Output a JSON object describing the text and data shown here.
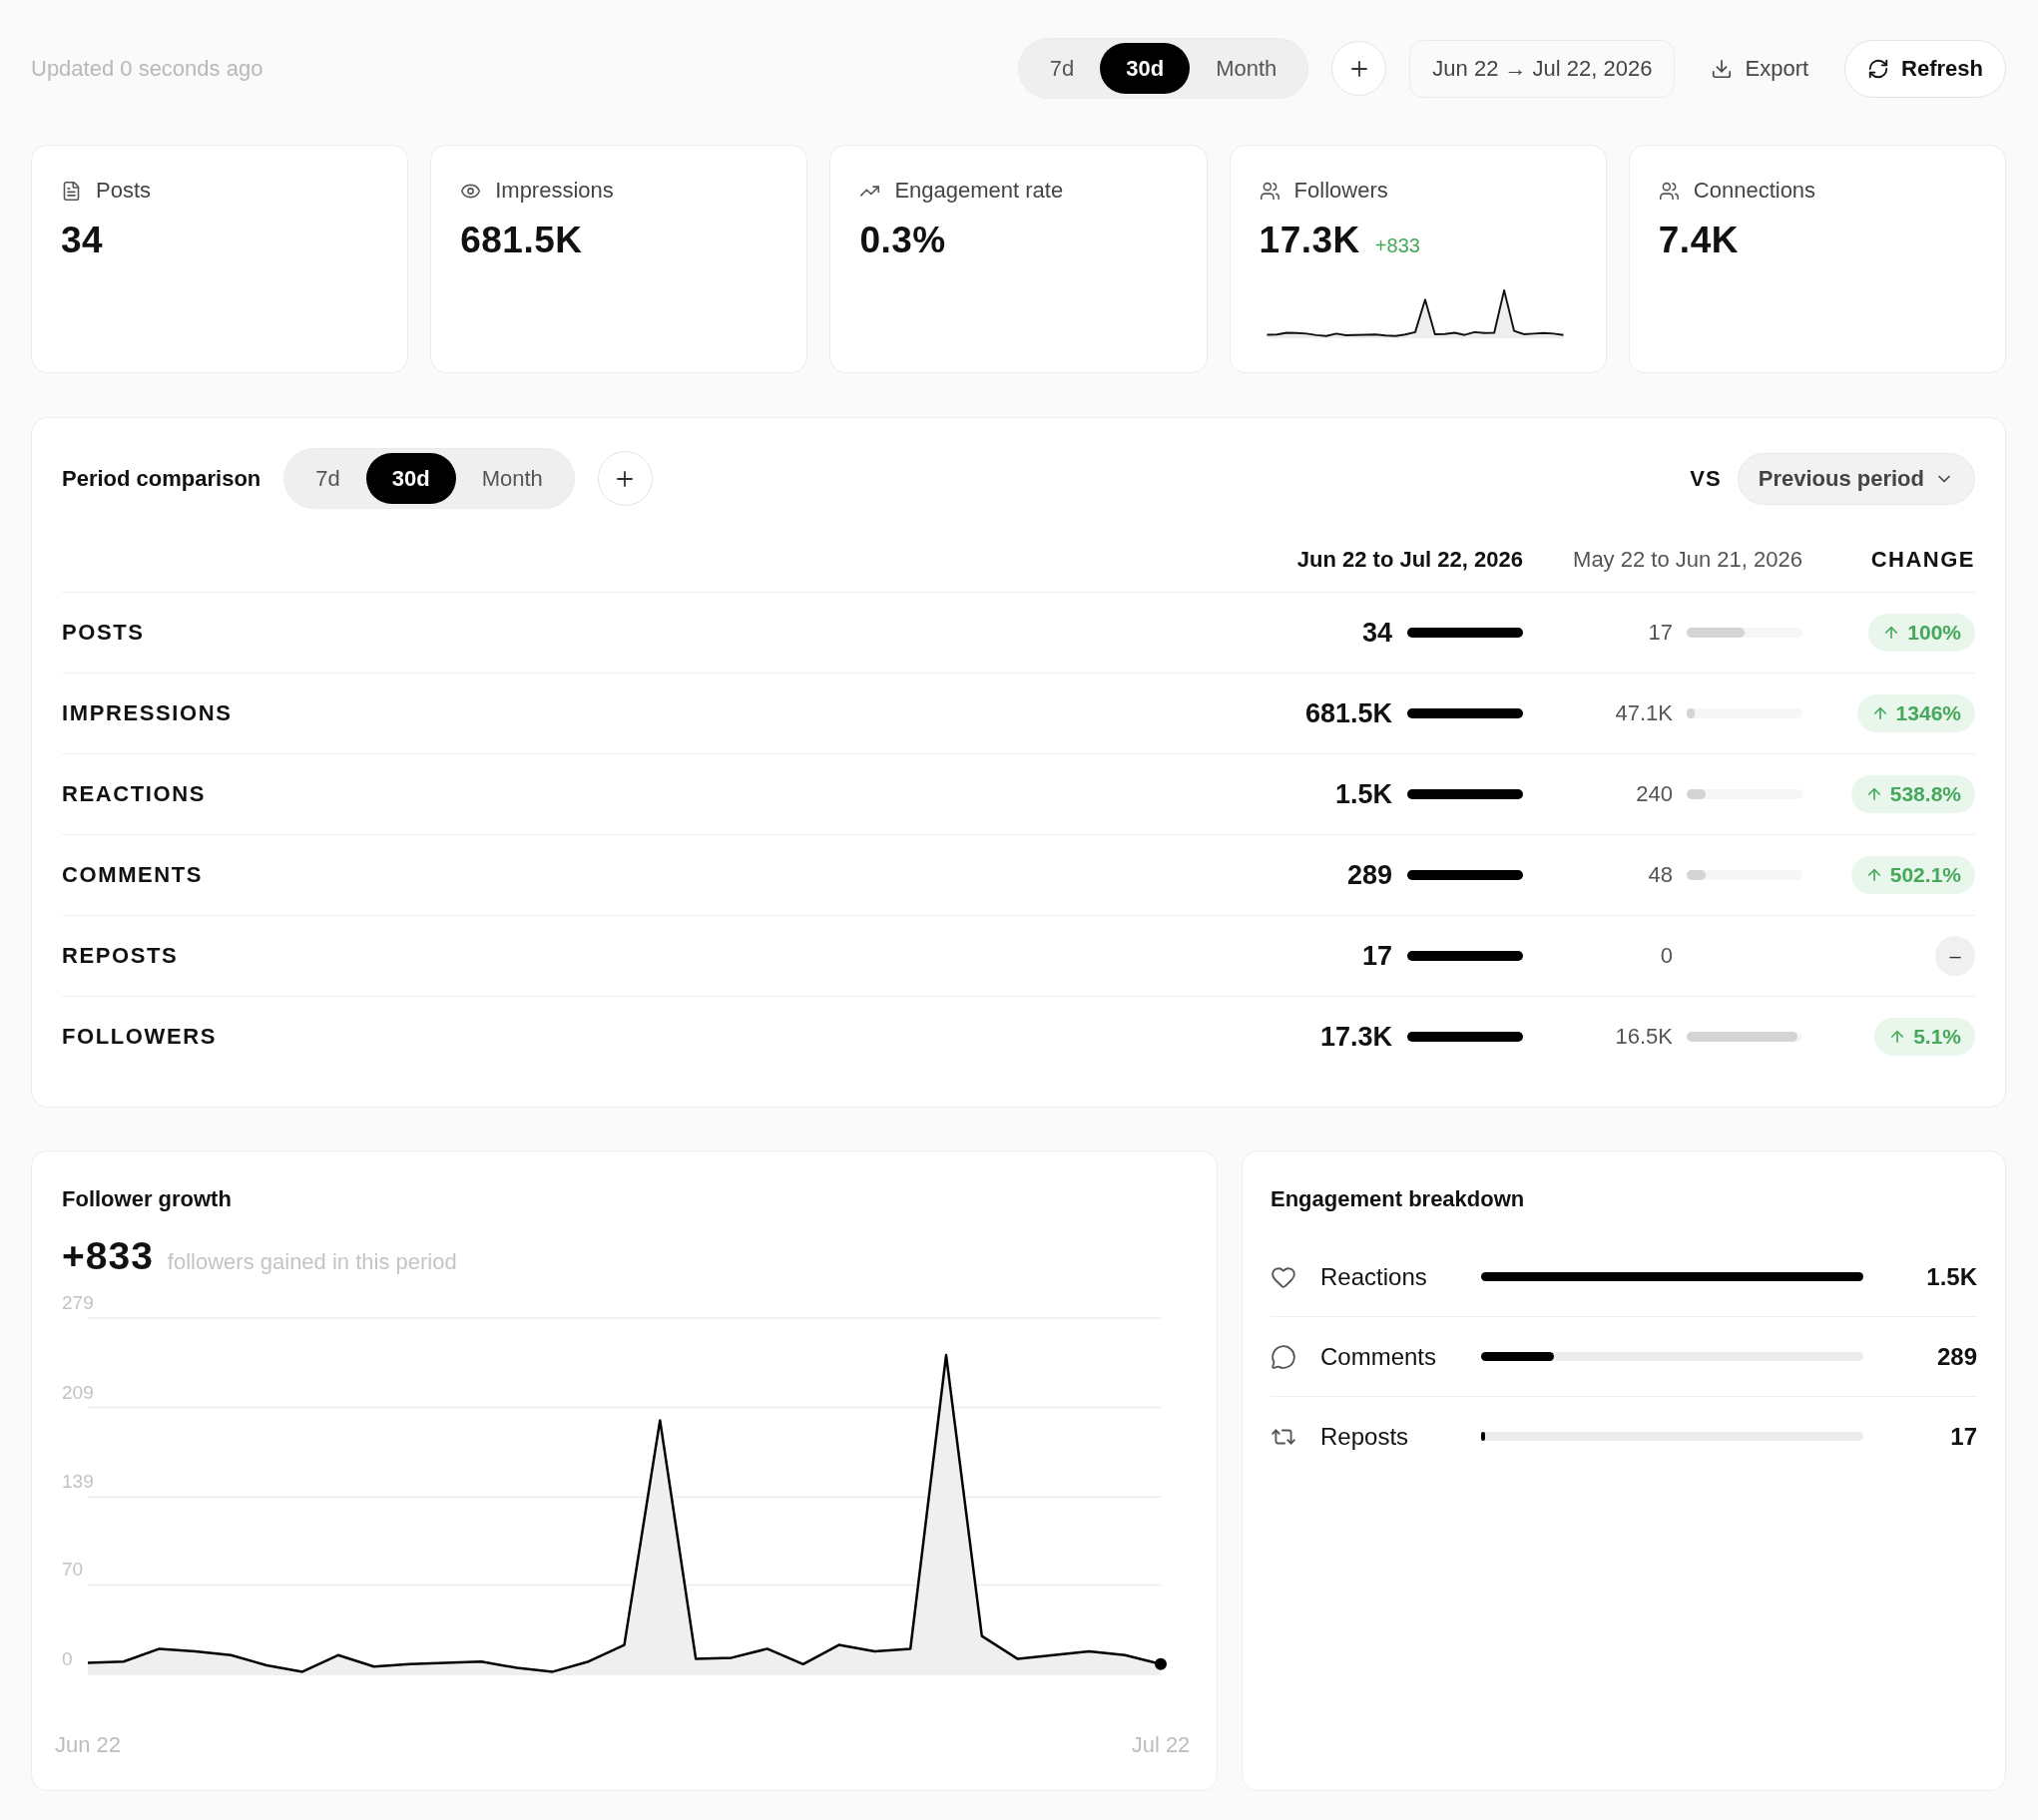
{
  "header": {
    "updated": "Updated 0 seconds ago",
    "ranges": [
      {
        "label": "7d",
        "selected": false
      },
      {
        "label": "30d",
        "selected": true
      },
      {
        "label": "Month",
        "selected": false
      }
    ],
    "date_range": "Jun 22 → Jul 22, 2026",
    "export": "Export",
    "refresh": "Refresh"
  },
  "stats": [
    {
      "kind": "posts",
      "label": "Posts",
      "value": "34",
      "sparkline": false
    },
    {
      "kind": "impressions",
      "label": "Impressions",
      "value": "681.5K",
      "sparkline": false
    },
    {
      "kind": "engagement",
      "label": "Engagement rate",
      "value": "0.3%",
      "sparkline": false
    },
    {
      "kind": "followers",
      "label": "Followers",
      "value": "17.3K",
      "delta": "+833",
      "sparkline": true
    },
    {
      "kind": "connections",
      "label": "Connections",
      "value": "7.4K",
      "sparkline": false
    }
  ],
  "comparison": {
    "title": "Period comparison",
    "ranges": [
      {
        "label": "7d",
        "selected": false
      },
      {
        "label": "30d",
        "selected": true
      },
      {
        "label": "Month",
        "selected": false
      }
    ],
    "vs": "VS",
    "baseline": "Previous period",
    "columns": [
      "Jun 22 to Jul 22, 2026",
      "May 22 to Jun 21, 2026",
      "CHANGE"
    ],
    "rows": [
      {
        "label": "POSTS",
        "current": {
          "value": "34",
          "level": 1
        },
        "previous": {
          "value": "17",
          "level": 0.5
        },
        "change": {
          "kind": "up",
          "text": "100%"
        }
      },
      {
        "label": "IMPRESSIONS",
        "current": {
          "value": "681.5K",
          "level": 1
        },
        "previous": {
          "value": "47.1K",
          "level": 0.069
        },
        "change": {
          "kind": "up",
          "text": "1346%"
        }
      },
      {
        "label": "REACTIONS",
        "current": {
          "value": "1.5K",
          "level": 1
        },
        "previous": {
          "value": "240",
          "level": 0.16
        },
        "change": {
          "kind": "up",
          "text": "538.8%"
        }
      },
      {
        "label": "COMMENTS",
        "current": {
          "value": "289",
          "level": 1
        },
        "previous": {
          "value": "48",
          "level": 0.166
        },
        "change": {
          "kind": "up",
          "text": "502.1%"
        }
      },
      {
        "label": "REPOSTS",
        "current": {
          "value": "17",
          "level": 1
        },
        "previous": {
          "value": "0"
        },
        "change": {
          "kind": "flat",
          "text": "–"
        }
      },
      {
        "label": "FOLLOWERS",
        "current": {
          "value": "17.3K",
          "level": 1
        },
        "previous": {
          "value": "16.5K",
          "level": 0.954
        },
        "change": {
          "kind": "up",
          "text": "5.1%"
        }
      }
    ]
  },
  "follower_growth": {
    "title": "Follower growth",
    "total": "+833",
    "caption": "followers gained in this period",
    "chart_data": {
      "type": "area",
      "grid": true,
      "categories": [
        "Jun 22",
        null,
        null,
        null,
        null,
        null,
        null,
        null,
        null,
        null,
        null,
        null,
        null,
        null,
        null,
        null,
        null,
        null,
        null,
        null,
        null,
        null,
        null,
        null,
        null,
        null,
        null,
        null,
        null,
        null,
        "Jul 22"
      ],
      "ylim": [
        0,
        279
      ],
      "yticks": [
        0,
        70,
        139,
        209,
        279
      ],
      "series": [
        {
          "color": "#000000",
          "values": [
            9,
            10,
            20,
            18,
            15,
            7,
            2,
            15,
            6,
            8,
            9,
            10,
            5,
            2,
            10,
            23,
            199,
            12,
            13,
            20,
            8,
            23,
            18,
            20,
            250,
            30,
            12,
            15,
            18,
            15,
            8
          ]
        }
      ]
    }
  },
  "engagement": {
    "title": "Engagement breakdown",
    "items": [
      {
        "kind": "reactions",
        "label": "Reactions",
        "value": "1.5K",
        "level": 1
      },
      {
        "kind": "comments",
        "label": "Comments",
        "value": "289",
        "level": 0.19
      },
      {
        "kind": "reposts",
        "label": "Reposts",
        "value": "17",
        "level": 0.011
      }
    ]
  }
}
